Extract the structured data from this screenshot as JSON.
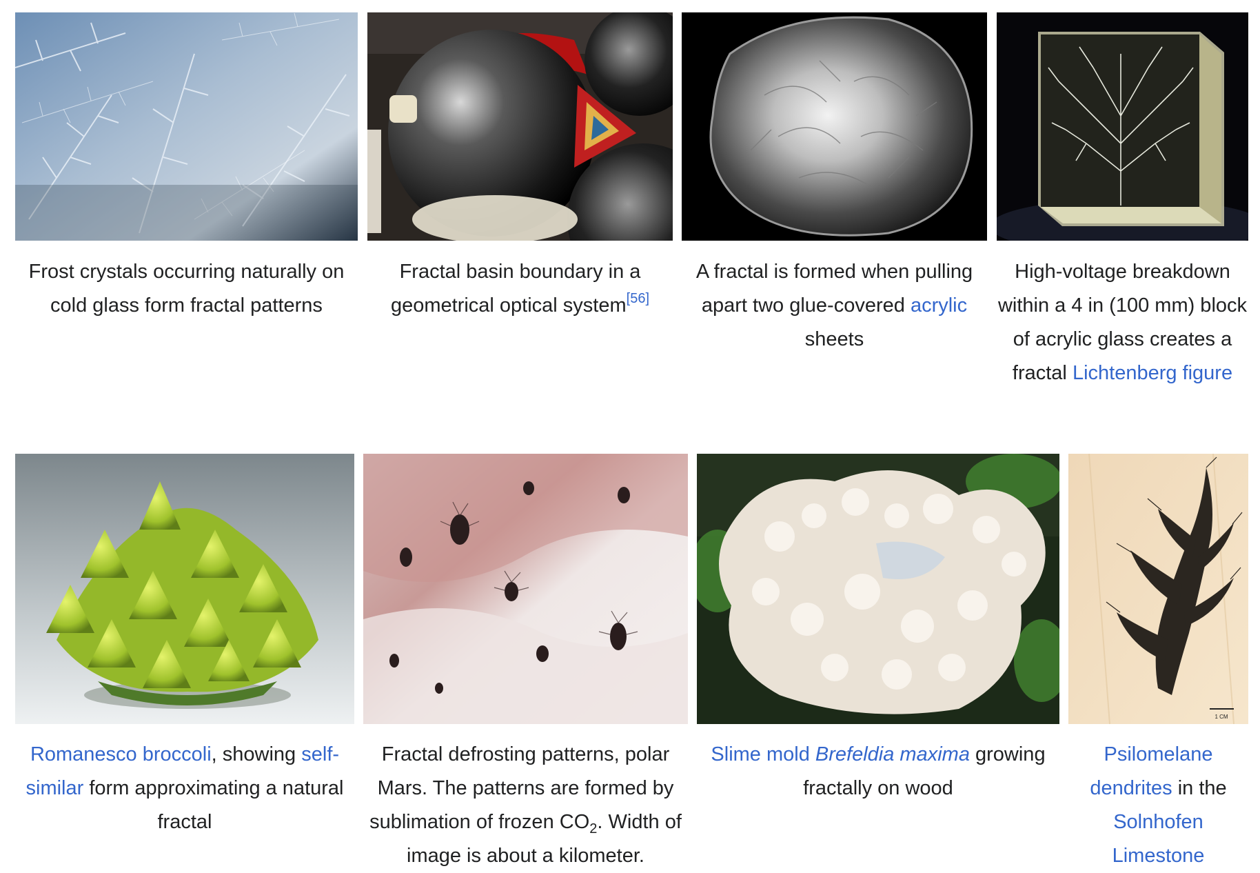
{
  "gallery": {
    "items": [
      {
        "id": "frost",
        "image_alt": "Frost crystals on cold glass",
        "caption": {
          "text": "Frost crystals occurring naturally on cold glass form fractal patterns"
        }
      },
      {
        "id": "basin",
        "image_alt": "Fractal basin boundary in a geometrical optical system",
        "caption": {
          "text": "Fractal basin boundary in a geometrical optical system",
          "ref": "[56]"
        }
      },
      {
        "id": "glue",
        "image_alt": "Fractal formed by pulling apart glue-covered acrylic sheets",
        "caption": {
          "pre": "A fractal is formed when pulling apart two glue-covered ",
          "link": "acrylic",
          "post": " sheets"
        }
      },
      {
        "id": "lichtenberg",
        "image_alt": "Lichtenberg figure in acrylic glass block",
        "caption": {
          "pre": "High-voltage breakdown within a 4 in (100 mm) block of acrylic glass creates a fractal ",
          "link": "Lichtenberg figure"
        }
      },
      {
        "id": "romanesco",
        "image_alt": "Romanesco broccoli",
        "caption": {
          "link1": "Romanesco broccoli",
          "mid": ", showing ",
          "link2": "self-similar",
          "post": " form approximating a natural fractal"
        }
      },
      {
        "id": "mars",
        "image_alt": "Fractal defrosting patterns on polar Mars",
        "caption": {
          "pre": "Fractal defrosting patterns, polar Mars. The patterns are formed by sublimation of frozen CO",
          "sub": "2",
          "post": ". Width of image is about a kilometer."
        }
      },
      {
        "id": "slime",
        "image_alt": "Slime mold Brefeldia maxima growing on wood",
        "caption": {
          "link1": "Slime mold",
          "link2": "Brefeldia maxima",
          "post": " growing fractally on wood"
        }
      },
      {
        "id": "psilomelane",
        "image_alt": "Psilomelane dendrites in Solnhofen Limestone",
        "caption": {
          "link1": "Psilomelane",
          "link2": "dendrites",
          "mid": " in the ",
          "link3": "Solnhofen Limestone"
        },
        "scale_text": "1 CM"
      }
    ]
  },
  "colors": {
    "text": "#202122",
    "link": "#3366cc",
    "background": "#ffffff"
  }
}
